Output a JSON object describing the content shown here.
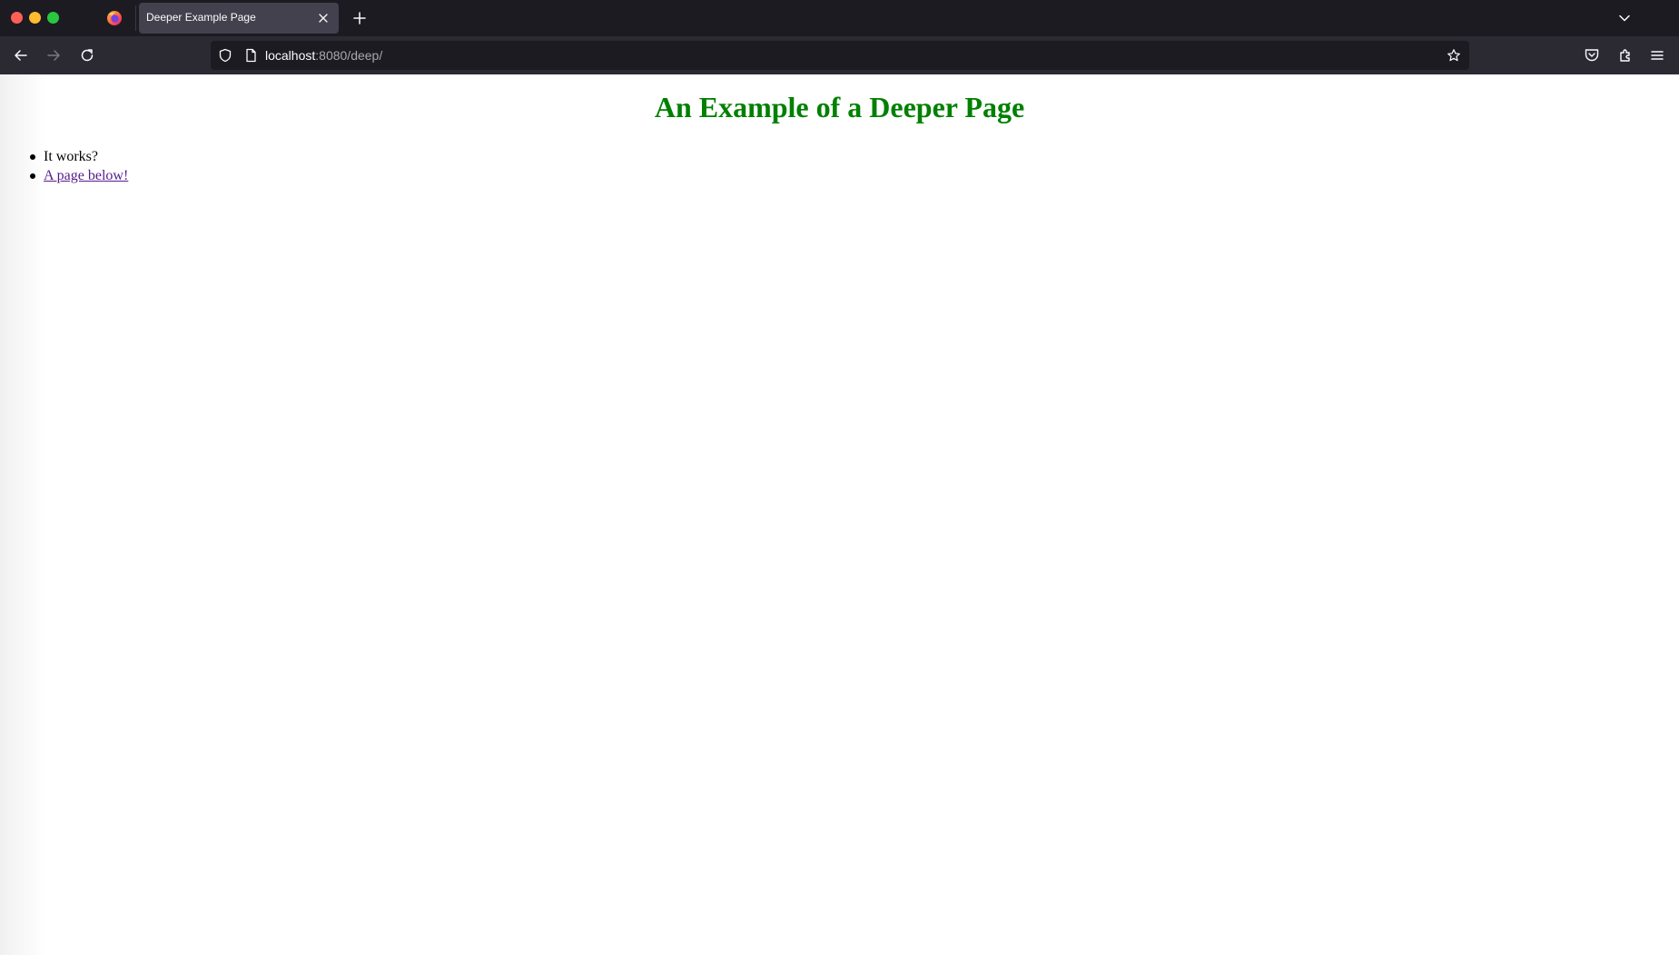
{
  "browser": {
    "tab": {
      "title": "Deeper Example Page"
    },
    "urlbar": {
      "host": "localhost",
      "path": ":8080/deep/"
    },
    "icons": {
      "firefox": "firefox-logo-icon",
      "close_tab": "close-icon",
      "new_tab": "plus-icon",
      "tab_list": "chevron-down-icon",
      "back": "arrow-left-icon",
      "forward": "arrow-right-icon",
      "reload": "reload-icon",
      "shield": "shield-icon",
      "page": "page-icon",
      "bookmark": "star-icon",
      "pocket": "pocket-icon",
      "extensions": "puzzle-icon",
      "menu": "hamburger-menu-icon"
    }
  },
  "page": {
    "heading": "An Example of a Deeper Page",
    "heading_color": "#008000",
    "items": [
      {
        "text": "It works?"
      },
      {
        "link_text": "A page below!"
      }
    ],
    "link_color": "#551a8b"
  }
}
